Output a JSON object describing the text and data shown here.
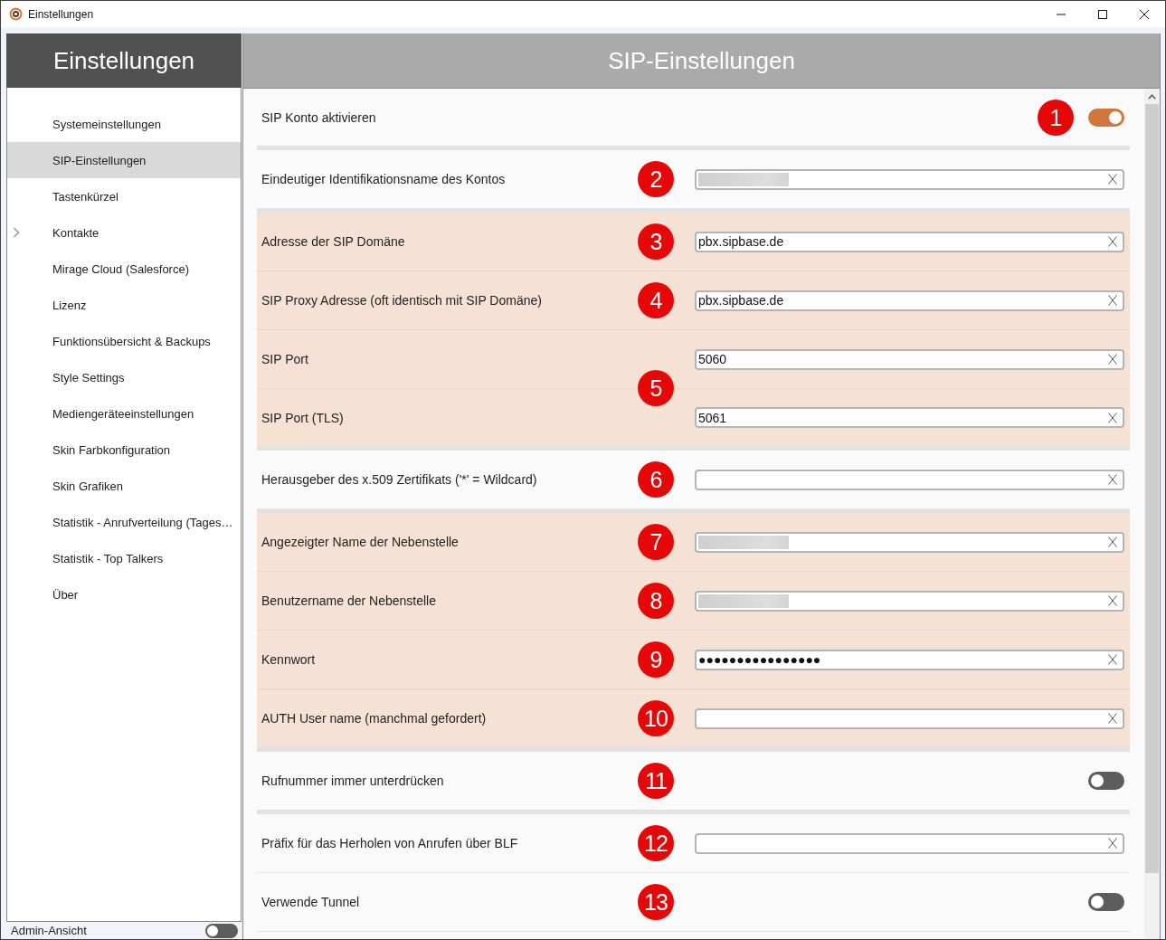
{
  "window": {
    "title": "Einstellungen"
  },
  "sidebar": {
    "title": "Einstellungen",
    "items": [
      {
        "label": "Systemeinstellungen",
        "selected": false,
        "expandable": false
      },
      {
        "label": "SIP-Einstellungen",
        "selected": true,
        "expandable": false
      },
      {
        "label": "Tastenkürzel",
        "selected": false,
        "expandable": false
      },
      {
        "label": "Kontakte",
        "selected": false,
        "expandable": true
      },
      {
        "label": "Mirage Cloud (Salesforce)",
        "selected": false,
        "expandable": false
      },
      {
        "label": "Lizenz",
        "selected": false,
        "expandable": false
      },
      {
        "label": "Funktionsübersicht & Backups",
        "selected": false,
        "expandable": false
      },
      {
        "label": "Style Settings",
        "selected": false,
        "expandable": false
      },
      {
        "label": "Mediengeräteeinstellungen",
        "selected": false,
        "expandable": false
      },
      {
        "label": "Skin Farbkonfiguration",
        "selected": false,
        "expandable": false
      },
      {
        "label": "Skin Grafiken",
        "selected": false,
        "expandable": false
      },
      {
        "label": "Statistik - Anrufverteilung (Tages…",
        "selected": false,
        "expandable": false
      },
      {
        "label": "Statistik - Top Talkers",
        "selected": false,
        "expandable": false
      },
      {
        "label": "Über",
        "selected": false,
        "expandable": false
      }
    ],
    "footer": {
      "label": "Admin-Ansicht",
      "on": false
    }
  },
  "panel": {
    "title": "SIP-Einstellungen",
    "sections": [
      {
        "highlighted": false,
        "items": [
          {
            "badge": "1",
            "lines": [
              {
                "label": "SIP Konto aktivieren",
                "kind": "toggle",
                "on": true
              }
            ]
          }
        ]
      },
      {
        "highlighted": false,
        "items": [
          {
            "badge": "2",
            "lines": [
              {
                "label": "Eindeutiger Identifikationsname des Kontos",
                "kind": "text",
                "redacted": true
              }
            ]
          }
        ]
      },
      {
        "highlighted": true,
        "items": [
          {
            "badge": "3",
            "lines": [
              {
                "label": "Adresse der SIP Domäne",
                "kind": "text",
                "value": "pbx.sipbase.de",
                "redacted": false
              }
            ]
          },
          {
            "badge": "4",
            "lines": [
              {
                "label": "SIP Proxy Adresse (oft identisch mit SIP Domäne)",
                "kind": "text",
                "value": "pbx.sipbase.de",
                "redacted": false
              }
            ]
          },
          {
            "badge": "5",
            "lines": [
              {
                "label": "SIP Port",
                "kind": "text",
                "value": "5060",
                "redacted": false
              },
              {
                "label": "SIP Port (TLS)",
                "kind": "text",
                "value": "5061",
                "redacted": false
              }
            ]
          }
        ]
      },
      {
        "highlighted": false,
        "items": [
          {
            "badge": "6",
            "lines": [
              {
                "label": "Herausgeber des x.509 Zertifikats ('*' = Wildcard)",
                "kind": "text",
                "redacted": false
              }
            ]
          }
        ]
      },
      {
        "highlighted": true,
        "items": [
          {
            "badge": "7",
            "lines": [
              {
                "label": "Angezeigter Name der Nebenstelle",
                "kind": "text",
                "redacted": true
              }
            ]
          },
          {
            "badge": "8",
            "lines": [
              {
                "label": "Benutzername der Nebenstelle",
                "kind": "text",
                "redacted": true
              }
            ]
          },
          {
            "badge": "9",
            "lines": [
              {
                "label": "Kennwort",
                "kind": "text",
                "value": "●●●●●●●●●●●●●●●●",
                "redacted": false
              }
            ]
          },
          {
            "badge": "10",
            "lines": [
              {
                "label": "AUTH User name (manchmal gefordert)",
                "kind": "text",
                "redacted": false
              }
            ]
          }
        ]
      },
      {
        "highlighted": false,
        "items": [
          {
            "badge": "11",
            "lines": [
              {
                "label": "Rufnummer immer unterdrücken",
                "kind": "toggle",
                "on": false
              }
            ]
          }
        ]
      },
      {
        "highlighted": false,
        "items": [
          {
            "badge": "12",
            "lines": [
              {
                "label": "Präfix für das Herholen von Anrufen über BLF",
                "kind": "text",
                "redacted": false
              }
            ]
          },
          {
            "badge": "13",
            "lines": [
              {
                "label": "Verwende Tunnel",
                "kind": "toggle",
                "on": false
              }
            ]
          }
        ]
      }
    ]
  }
}
